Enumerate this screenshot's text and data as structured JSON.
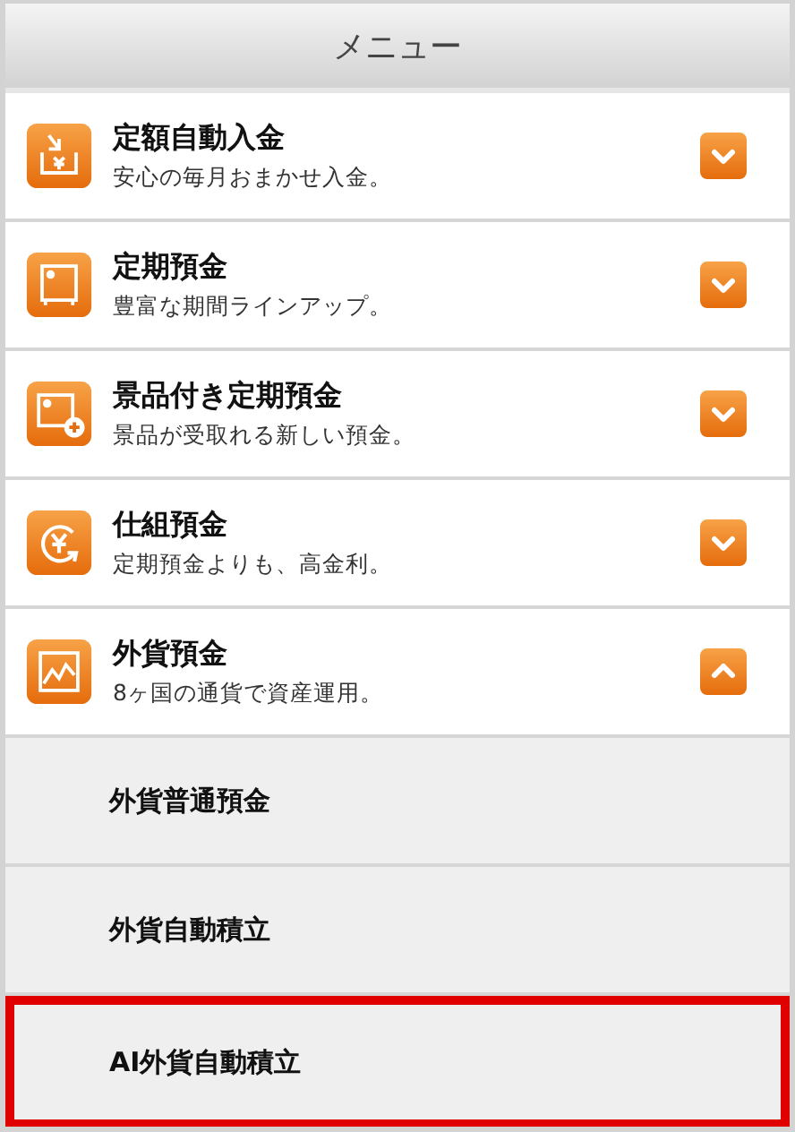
{
  "header": {
    "title": "メニュー"
  },
  "items": [
    {
      "title": "定額自動入金",
      "subtitle": "安心の毎月おまかせ入金。",
      "expanded": false
    },
    {
      "title": "定期預金",
      "subtitle": "豊富な期間ラインアップ。",
      "expanded": false
    },
    {
      "title": "景品付き定期預金",
      "subtitle": "景品が受取れる新しい預金。",
      "expanded": false
    },
    {
      "title": "仕組預金",
      "subtitle": "定期預金よりも、高金利。",
      "expanded": false
    },
    {
      "title": "外貨預金",
      "subtitle": "8ヶ国の通貨で資産運用。",
      "expanded": true
    }
  ],
  "subitems": [
    {
      "label": "外貨普通預金",
      "highlighted": false
    },
    {
      "label": "外貨自動積立",
      "highlighted": false
    },
    {
      "label": "AI外貨自動積立",
      "highlighted": true
    }
  ]
}
